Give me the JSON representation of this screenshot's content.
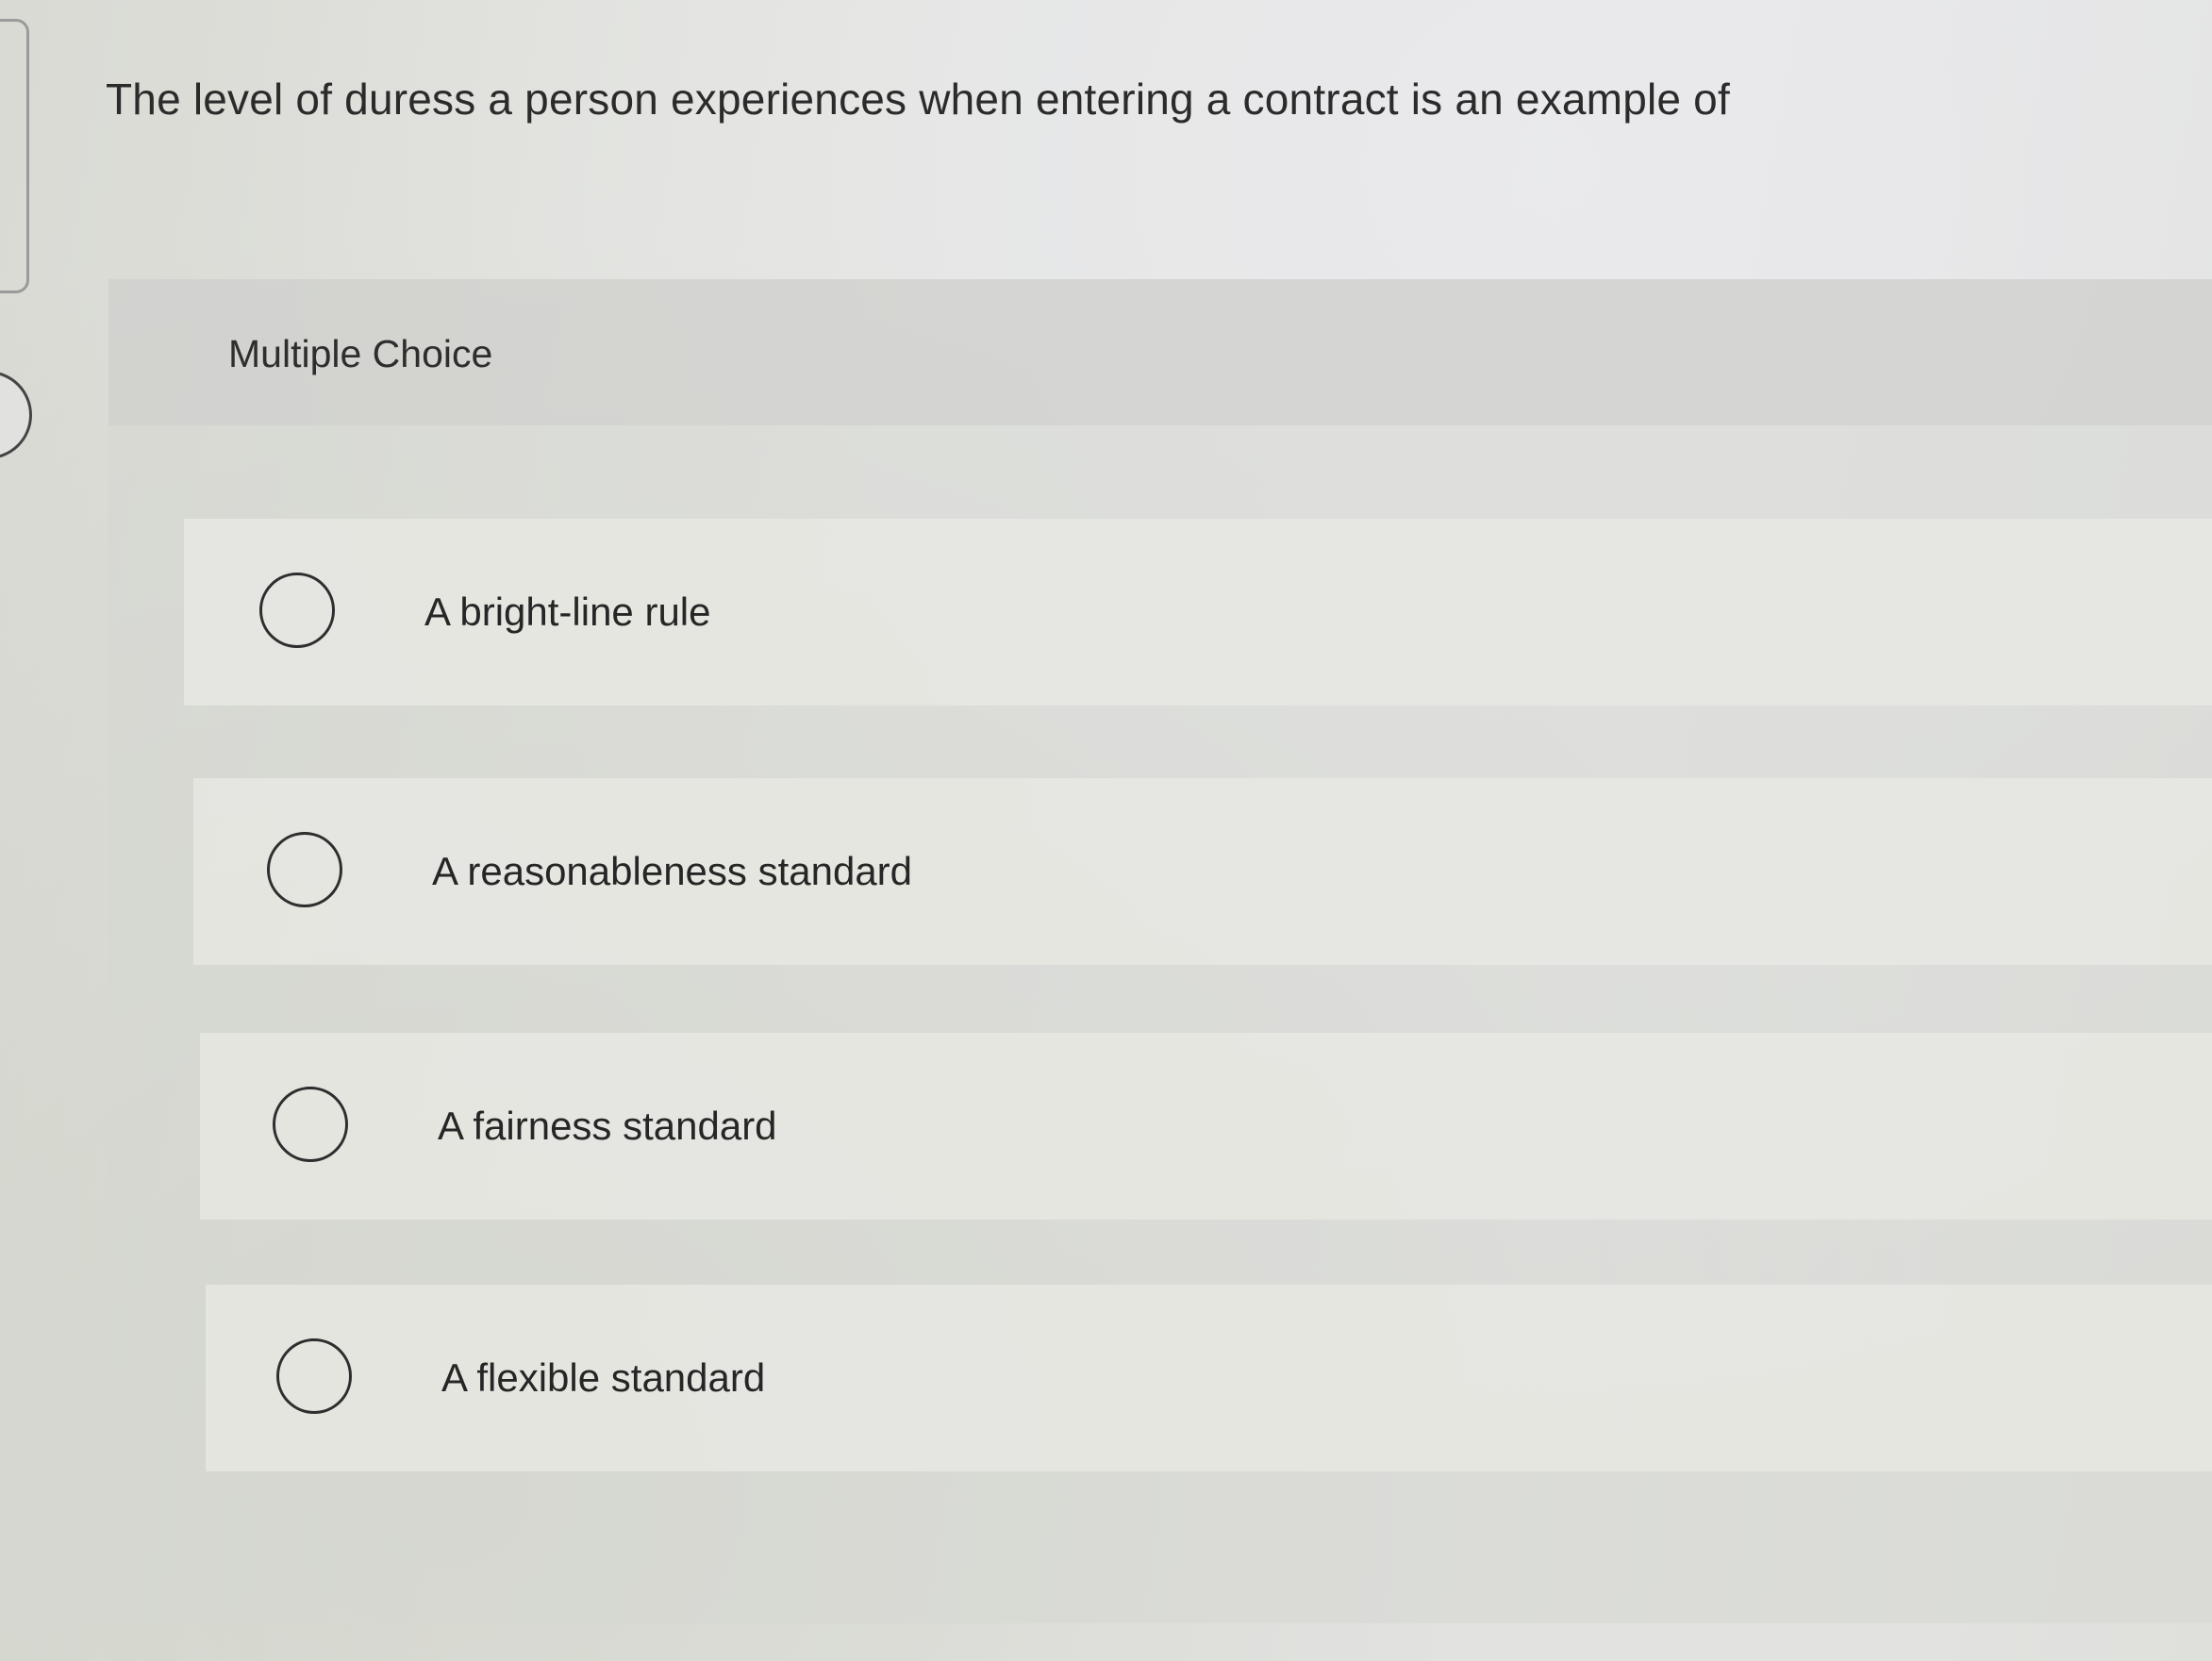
{
  "question": {
    "text": "The level of duress a person experiences when entering a contract is an example of"
  },
  "choice_panel": {
    "type_label": "Multiple Choice",
    "options": [
      {
        "label": "A bright-line rule",
        "selected": false
      },
      {
        "label": "A reasonableness standard",
        "selected": false
      },
      {
        "label": "A fairness standard",
        "selected": false
      },
      {
        "label": "A flexible standard",
        "selected": false
      }
    ]
  }
}
